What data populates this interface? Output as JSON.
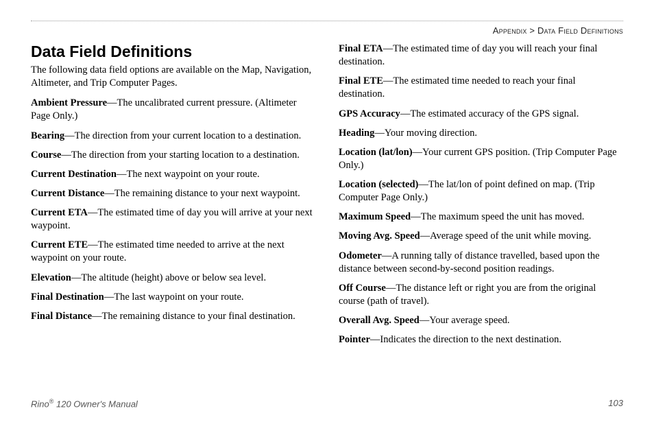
{
  "breadcrumb": {
    "section": "Appendix",
    "sep": ">",
    "page": "Data Field Definitions"
  },
  "title": "Data Field Definitions",
  "intro": "The following data field options are available on the Map, Navigation, Altimeter, and Trip Computer Pages.",
  "definitions": [
    {
      "term": "Ambient Pressure",
      "desc": "—The uncalibrated current pressure. (Altimeter Page Only.)"
    },
    {
      "term": "Bearing",
      "desc": "—The direction from your current location to a destination."
    },
    {
      "term": "Course",
      "desc": "—The direction from your starting location to a destination."
    },
    {
      "term": "Current Destination",
      "desc": "—The next waypoint on your route."
    },
    {
      "term": "Current Distance",
      "desc": "—The remaining distance to your next waypoint."
    },
    {
      "term": "Current ETA",
      "desc": "—The estimated time of day you will arrive at your next waypoint."
    },
    {
      "term": "Current ETE",
      "desc": "—The estimated time needed to arrive at the next waypoint on your route."
    },
    {
      "term": "Elevation",
      "desc": "—The altitude (height) above or below sea level."
    },
    {
      "term": "Final Destination",
      "desc": "—The last waypoint on your route."
    },
    {
      "term": "Final Distance",
      "desc": "—The remaining distance to your final destination."
    },
    {
      "term": "Final ETA",
      "desc": "—The estimated time of day you will reach your final destination."
    },
    {
      "term": "Final ETE",
      "desc": "—The estimated time needed to reach your final destination."
    },
    {
      "term": "GPS Accuracy",
      "desc": "—The estimated accuracy of the GPS signal."
    },
    {
      "term": "Heading",
      "desc": "—Your moving direction."
    },
    {
      "term": "Location (lat/lon)",
      "desc": "—Your current GPS position. (Trip Computer Page Only.)"
    },
    {
      "term": "Location (selected)",
      "desc": "—The lat/lon of point defined on map. (Trip Computer Page Only.)"
    },
    {
      "term": "Maximum Speed",
      "desc": "—The maximum speed the unit has moved."
    },
    {
      "term": "Moving Avg. Speed",
      "desc": "—Average speed of the unit while moving."
    },
    {
      "term": "Odometer",
      "desc": "—A running tally of distance travelled, based upon the distance between second-by-second position readings."
    },
    {
      "term": "Off Course",
      "desc": "—The distance left or right you are from the original course (path of travel)."
    },
    {
      "term": "Overall Avg. Speed",
      "desc": "—Your average speed."
    },
    {
      "term": "Pointer",
      "desc": "—Indicates the direction to the next destination."
    }
  ],
  "footer": {
    "product_prefix": "Rino",
    "regmark": "®",
    "product_suffix": " 120 Owner's Manual",
    "page_number": "103"
  }
}
